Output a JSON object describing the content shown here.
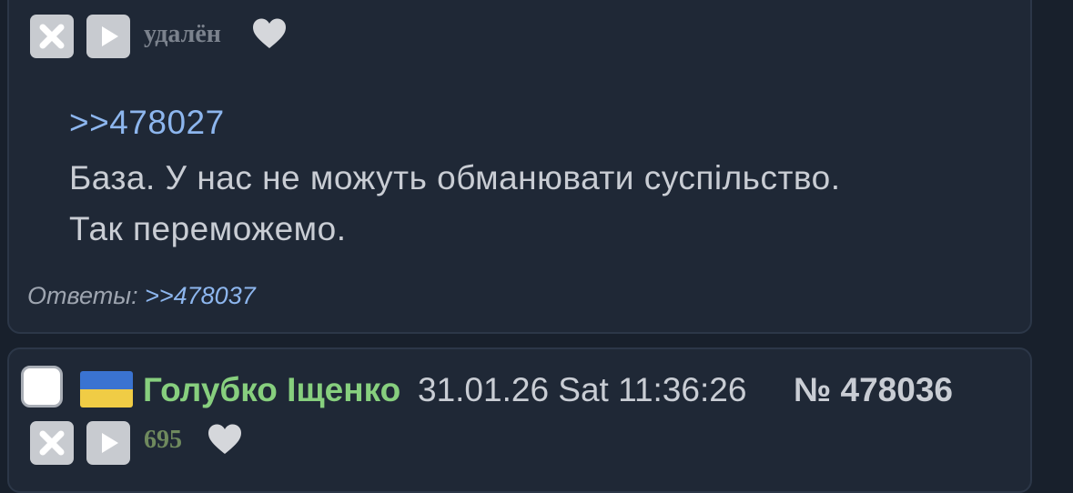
{
  "post1": {
    "status": "удалён",
    "reply_link": ">>478027",
    "body_lines": [
      "База. У нас не можуть обманювати суспільство.",
      "Так переможемо."
    ],
    "answers_label": "Ответы:",
    "answers_link": ">>478037"
  },
  "post2": {
    "poster_name": "Голубко Іщенко",
    "date": "31.01.26 Sat 11:36:26",
    "number_prefix": "№",
    "number": "478036",
    "status": "695"
  },
  "icons": {
    "hide": "close-icon",
    "play": "play-icon",
    "like": "heart-icon",
    "flag": "ukraine-flag-icon"
  },
  "colors": {
    "background": "#18202c",
    "post_background": "#1f2836",
    "link": "#8db6ee",
    "poster_name": "#87cf7e",
    "text": "#c9cdd4",
    "muted": "#7b828d"
  }
}
